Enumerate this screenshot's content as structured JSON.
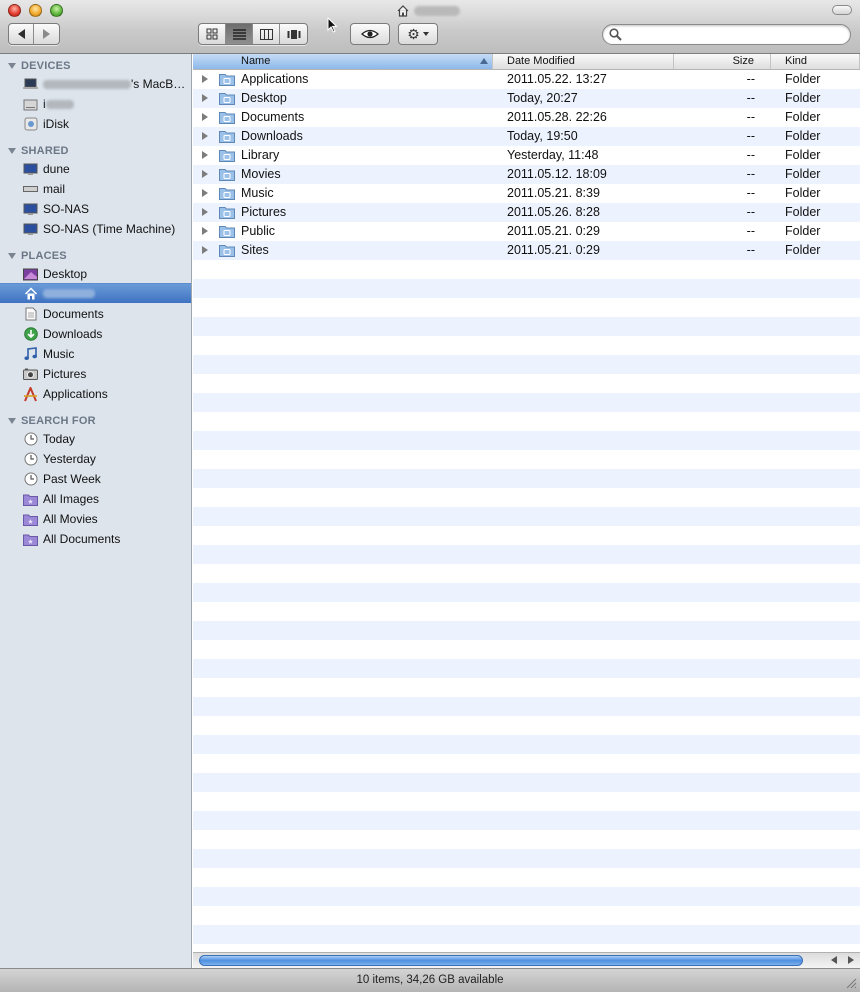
{
  "toolbar": {
    "back_icon": "back-arrow-icon",
    "forward_icon": "forward-arrow-icon",
    "views": [
      "icon-view",
      "list-view",
      "column-view",
      "cover-flow-view"
    ],
    "selected_view": "list-view",
    "search": {
      "value": "",
      "placeholder": ""
    }
  },
  "sidebar": {
    "devices": {
      "header": "DEVICES",
      "items": [
        {
          "label": "'s MacB…",
          "icon": "laptop-icon"
        },
        {
          "label": "i",
          "icon": "disk-icon"
        },
        {
          "label": "iDisk",
          "icon": "idisk-icon"
        }
      ]
    },
    "shared": {
      "header": "SHARED",
      "items": [
        {
          "label": "dune",
          "icon": "computer-icon"
        },
        {
          "label": "mail",
          "icon": "server-icon"
        },
        {
          "label": "SO-NAS",
          "icon": "computer-icon"
        },
        {
          "label": "SO-NAS (Time Machine)",
          "icon": "computer-icon"
        }
      ]
    },
    "places": {
      "header": "PLACES",
      "items": [
        {
          "label": "Desktop",
          "icon": "desktop-icon"
        },
        {
          "label": "",
          "icon": "home-icon",
          "selected": true
        },
        {
          "label": "Documents",
          "icon": "documents-icon"
        },
        {
          "label": "Downloads",
          "icon": "downloads-icon"
        },
        {
          "label": "Music",
          "icon": "music-icon"
        },
        {
          "label": "Pictures",
          "icon": "pictures-icon"
        },
        {
          "label": "Applications",
          "icon": "applications-icon"
        }
      ]
    },
    "search_for": {
      "header": "SEARCH FOR",
      "items": [
        {
          "label": "Today",
          "icon": "clock-icon"
        },
        {
          "label": "Yesterday",
          "icon": "clock-icon"
        },
        {
          "label": "Past Week",
          "icon": "clock-icon"
        },
        {
          "label": "All Images",
          "icon": "smart-folder-icon"
        },
        {
          "label": "All Movies",
          "icon": "smart-folder-icon"
        },
        {
          "label": "All Documents",
          "icon": "smart-folder-icon"
        }
      ]
    }
  },
  "list": {
    "columns": {
      "name": "Name",
      "date": "Date Modified",
      "size": "Size",
      "kind": "Kind"
    },
    "rows": [
      {
        "name": "Applications",
        "date": "2011.05.22. 13:27",
        "size": "--",
        "kind": "Folder"
      },
      {
        "name": "Desktop",
        "date": "Today, 20:27",
        "size": "--",
        "kind": "Folder"
      },
      {
        "name": "Documents",
        "date": "2011.05.28. 22:26",
        "size": "--",
        "kind": "Folder"
      },
      {
        "name": "Downloads",
        "date": "Today, 19:50",
        "size": "--",
        "kind": "Folder"
      },
      {
        "name": "Library",
        "date": "Yesterday, 11:48",
        "size": "--",
        "kind": "Folder"
      },
      {
        "name": "Movies",
        "date": "2011.05.12. 18:09",
        "size": "--",
        "kind": "Folder"
      },
      {
        "name": "Music",
        "date": "2011.05.21. 8:39",
        "size": "--",
        "kind": "Folder"
      },
      {
        "name": "Pictures",
        "date": "2011.05.26. 8:28",
        "size": "--",
        "kind": "Folder"
      },
      {
        "name": "Public",
        "date": "2011.05.21. 0:29",
        "size": "--",
        "kind": "Folder"
      },
      {
        "name": "Sites",
        "date": "2011.05.21. 0:29",
        "size": "--",
        "kind": "Folder"
      }
    ]
  },
  "status": {
    "text": "10 items, 34,26 GB available"
  },
  "colors": {
    "selection": "#3f73c2",
    "sidebar_bg": "#dde4ec",
    "row_alt": "#edf3fe"
  }
}
